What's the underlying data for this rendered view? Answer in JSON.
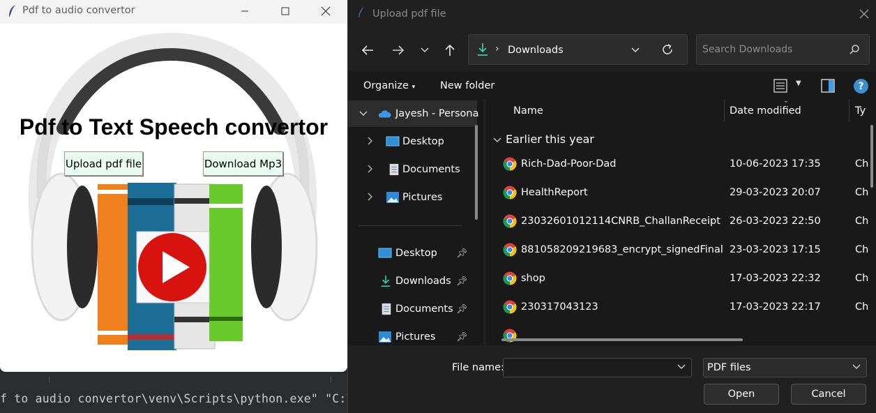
{
  "terminal": {
    "command_text": "f to audio convertor\\venv\\Scripts\\python.exe\" \"C:\\U"
  },
  "app_window": {
    "title": "Pdf to audio convertor",
    "heading": "Pdf to Text Speech convertor",
    "upload_button": "Upload pdf file",
    "download_button": "Download Mp3"
  },
  "dialog": {
    "title": "Upload pdf file",
    "address": {
      "location": "Downloads"
    },
    "search": {
      "placeholder": "Search Downloads"
    },
    "commands": {
      "organize": "Organize",
      "new_folder": "New folder"
    },
    "nav_pane": {
      "top_item": "Jayesh - Persona",
      "tree_items": [
        "Desktop",
        "Documents",
        "Pictures"
      ],
      "quick_access": [
        "Desktop",
        "Downloads",
        "Documents",
        "Pictures"
      ]
    },
    "columns": {
      "name": "Name",
      "date_modified": "Date modified",
      "type": "Ty"
    },
    "group_header": "Earlier this year",
    "files": [
      {
        "name": "Rich-Dad-Poor-Dad",
        "date": "10-06-2023 17:35",
        "type": "Ch"
      },
      {
        "name": "HealthReport",
        "date": "29-03-2023 20:07",
        "type": "Ch"
      },
      {
        "name": "23032601012114CNRB_ChallanReceipt",
        "date": "26-03-2023 22:50",
        "type": "Ch"
      },
      {
        "name": "881058209219683_encrypt_signedFinal",
        "date": "23-03-2023 17:15",
        "type": "Ch"
      },
      {
        "name": "shop",
        "date": "17-03-2023 22:32",
        "type": "Ch"
      },
      {
        "name": "230317043123",
        "date": "17-03-2023 22:17",
        "type": "Ch"
      }
    ],
    "footer": {
      "file_name_label": "File name:",
      "file_name_value": "",
      "file_type": "PDF files",
      "open_button": "Open",
      "cancel_button": "Cancel"
    }
  }
}
